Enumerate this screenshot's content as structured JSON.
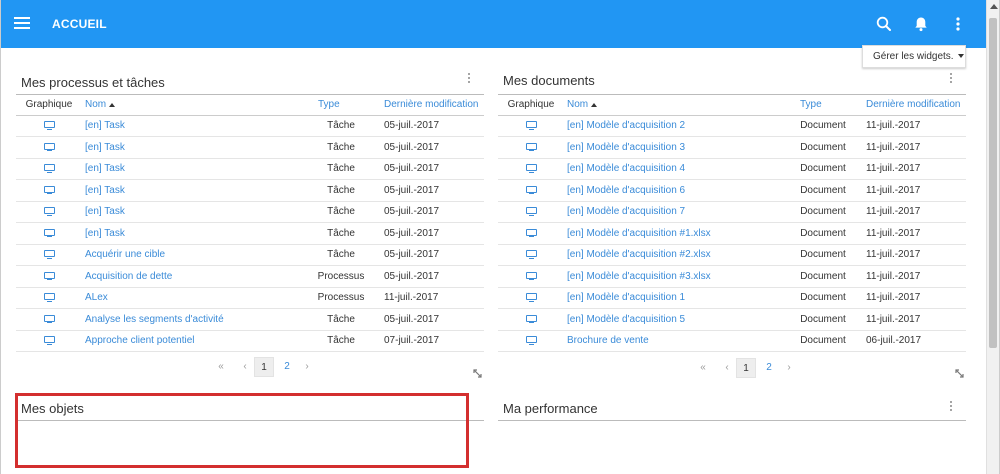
{
  "header": {
    "title": "ACCUEIL"
  },
  "widgets_button": {
    "label": "Gérer les widgets."
  },
  "processes": {
    "title": "Mes processus et tâches",
    "columns": {
      "graphic": "Graphique",
      "name": "Nom",
      "type": "Type",
      "modified": "Dernière modification"
    },
    "rows": [
      {
        "name": "[en] Task",
        "type": "Tâche",
        "date": "05-juil.-2017"
      },
      {
        "name": "[en] Task",
        "type": "Tâche",
        "date": "05-juil.-2017"
      },
      {
        "name": "[en] Task",
        "type": "Tâche",
        "date": "05-juil.-2017"
      },
      {
        "name": "[en] Task",
        "type": "Tâche",
        "date": "05-juil.-2017"
      },
      {
        "name": "[en] Task",
        "type": "Tâche",
        "date": "05-juil.-2017"
      },
      {
        "name": "[en] Task",
        "type": "Tâche",
        "date": "05-juil.-2017"
      },
      {
        "name": "Acquérir une cible",
        "type": "Tâche",
        "date": "05-juil.-2017"
      },
      {
        "name": "Acquisition de dette",
        "type": "Processus",
        "date": "05-juil.-2017"
      },
      {
        "name": "ALex",
        "type": "Processus",
        "date": "11-juil.-2017"
      },
      {
        "name": "Analyse les segments d'activité",
        "type": "Tâche",
        "date": "05-juil.-2017"
      },
      {
        "name": "Approche client potentiel",
        "type": "Tâche",
        "date": "07-juil.-2017"
      }
    ],
    "pagination": {
      "first": "«",
      "prev": "‹",
      "next": "›",
      "page1": "1",
      "page2": "2"
    }
  },
  "documents": {
    "title": "Mes documents",
    "columns": {
      "graphic": "Graphique",
      "name": "Nom",
      "type": "Type",
      "modified": "Dernière modification"
    },
    "rows": [
      {
        "name": "[en] Modèle d'acquisition 2",
        "type": "Document",
        "date": "11-juil.-2017"
      },
      {
        "name": "[en] Modèle d'acquisition 3",
        "type": "Document",
        "date": "11-juil.-2017"
      },
      {
        "name": "[en] Modèle d'acquisition 4",
        "type": "Document",
        "date": "11-juil.-2017"
      },
      {
        "name": "[en] Modèle d'acquisition 6",
        "type": "Document",
        "date": "11-juil.-2017"
      },
      {
        "name": "[en] Modèle d'acquisition 7",
        "type": "Document",
        "date": "11-juil.-2017"
      },
      {
        "name": "[en] Modèle d'acquisition #1.xlsx",
        "type": "Document",
        "date": "11-juil.-2017"
      },
      {
        "name": "[en] Modèle d'acquisition #2.xlsx",
        "type": "Document",
        "date": "11-juil.-2017"
      },
      {
        "name": "[en] Modèle d'acquisition #3.xlsx",
        "type": "Document",
        "date": "11-juil.-2017"
      },
      {
        "name": "[en] Modèle d'acquisition 1",
        "type": "Document",
        "date": "11-juil.-2017"
      },
      {
        "name": "[en] Modèle d'acquisition 5",
        "type": "Document",
        "date": "11-juil.-2017"
      },
      {
        "name": "Brochure de vente",
        "type": "Document",
        "date": "06-juil.-2017"
      }
    ],
    "pagination": {
      "first": "«",
      "prev": "‹",
      "next": "›",
      "page1": "1",
      "page2": "2"
    }
  },
  "objects": {
    "title": "Mes objets"
  },
  "performance": {
    "title": "Ma performance"
  },
  "colors": {
    "topbar": "#2196f3",
    "link": "#3a8bd8",
    "highlight": "#d32f2f"
  }
}
